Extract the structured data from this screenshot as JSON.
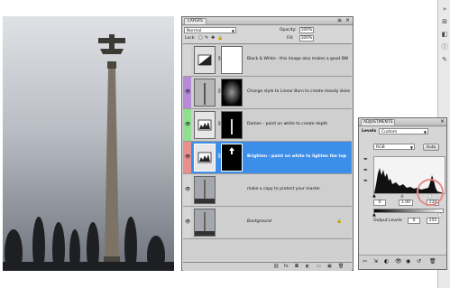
{
  "layers_panel": {
    "tab_label": "LAYERS",
    "blend_mode": "Normal",
    "opacity_label": "Opacity:",
    "opacity_value": "100%",
    "lock_label": "Lock:",
    "fill_label": "Fill:",
    "fill_value": "100%",
    "layers": [
      {
        "name": "Black & White - this image also makes a good BW",
        "color": "#d6d6d6",
        "visible": false,
        "active": false
      },
      {
        "name": "Change style to Linear Burn to create moody skies",
        "color": "#b58ad9",
        "visible": true,
        "active": false
      },
      {
        "name": "Darken - paint on white to create depth",
        "color": "#8ee08e",
        "visible": true,
        "active": false
      },
      {
        "name": "Brighten - paint on white to lighten the top",
        "color": "#e88f8f",
        "visible": true,
        "active": true
      },
      {
        "name": "make a copy to protect your master",
        "color": "#d6d6d6",
        "visible": true,
        "active": false
      },
      {
        "name": "Background",
        "color": "#d6d6d6",
        "visible": true,
        "active": false
      }
    ]
  },
  "adjustments_panel": {
    "tab_label": "ADJUSTMENTS",
    "tool_label": "Levels",
    "preset": "Custom",
    "channel": "RGB",
    "auto_label": "Auto",
    "input_black": "0",
    "input_gamma": "1.00",
    "input_white": "210",
    "output_label": "Output Levels:",
    "output_black": "0",
    "output_white": "255"
  },
  "colors": {
    "active_layer": "#3d8ee8",
    "purple_tag": "#b58ad9",
    "green_tag": "#8ee08e",
    "red_tag": "#e88f8f",
    "highlight_circle": "#e88a8a"
  }
}
